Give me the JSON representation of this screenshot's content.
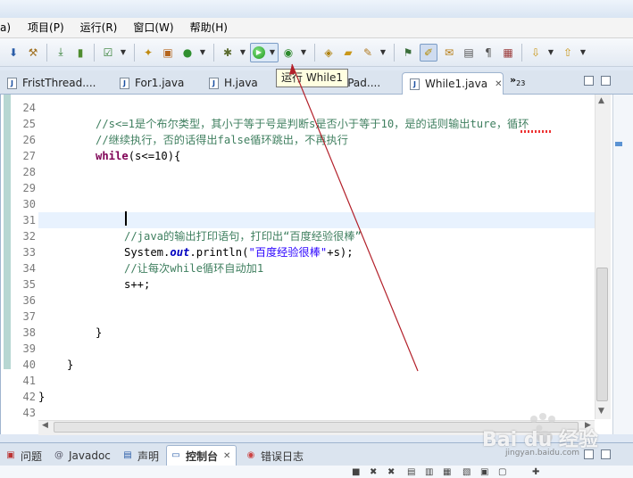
{
  "menu": {
    "items": [
      "a)",
      "项目(P)",
      "运行(R)",
      "窗口(W)",
      "帮助(H)"
    ]
  },
  "toolbar": {
    "tooltip": "运行 While1"
  },
  "editor_tabs": {
    "items": [
      {
        "label": "FristThread...."
      },
      {
        "label": "For1.java"
      },
      {
        "label": "H.java"
      },
      {
        "label": "VPad...."
      },
      {
        "label": "While1.java"
      }
    ],
    "overflow": "»",
    "overflow_count": "23"
  },
  "editor": {
    "lines": [
      {
        "no": "24",
        "text": ""
      },
      {
        "no": "25",
        "text": "        //s<=1是个布尔类型，其小于等于号是判断s是否小于等于10，是的话则输出ture，循环"
      },
      {
        "no": "26",
        "text": "        //继续执行，否的话得出false循环跳出，不再执行"
      },
      {
        "no": "27",
        "text": "        while(s<=10){"
      },
      {
        "no": "28",
        "text": ""
      },
      {
        "no": "29",
        "text": ""
      },
      {
        "no": "30",
        "text": ""
      },
      {
        "no": "31",
        "text": ""
      },
      {
        "no": "32",
        "text": "            //java的输出打印语句，打印出“百度经验很棒”"
      },
      {
        "no": "33",
        "text": "            System.out.println(\"百度经验很棒\"+s);"
      },
      {
        "no": "34",
        "text": "            //让每次while循环自动加1"
      },
      {
        "no": "35",
        "text": "            s++;"
      },
      {
        "no": "36",
        "text": ""
      },
      {
        "no": "37",
        "text": ""
      },
      {
        "no": "38",
        "text": "        }"
      },
      {
        "no": "39",
        "text": ""
      },
      {
        "no": "40",
        "text": "    }"
      },
      {
        "no": "41",
        "text": ""
      },
      {
        "no": "42",
        "text": "}"
      },
      {
        "no": "43",
        "text": ""
      }
    ],
    "code": {
      "l25": "//s<=1是个布尔类型，其小于等于号是判断s是否小于等于10，是的话则输出ture，循环",
      "l26": "//继续执行，否的话得出false循环跳出，不再执行",
      "l27_kw": "while",
      "l27_rest": "(s<=10){",
      "l32": "//java的输出打印语句，打印出“百度经验很棒”",
      "l33_a": "System.",
      "l33_b": "out",
      "l33_c": ".println(",
      "l33_d": "\"百度经验很棒\"",
      "l33_e": "+s);",
      "l34": "//让每次while循环自动加1",
      "l35": "s++;",
      "l38": "}",
      "l40": "}",
      "l42": "}"
    }
  },
  "bottom_panel": {
    "tabs": [
      {
        "label": "问题"
      },
      {
        "label": "Javadoc"
      },
      {
        "label": "声明"
      },
      {
        "label": "控制台"
      },
      {
        "label": "错误日志"
      }
    ],
    "close_glyph": "✕"
  },
  "watermark": {
    "text": "Bai du 经验",
    "url": "jingyan.baidu.com"
  },
  "colors": {
    "comment": "#3f7f5f",
    "keyword": "#7f0055",
    "string": "#2a00ff",
    "field": "#0000c0",
    "arrow": "#b3202a",
    "current_line": "#e8f2fe"
  }
}
